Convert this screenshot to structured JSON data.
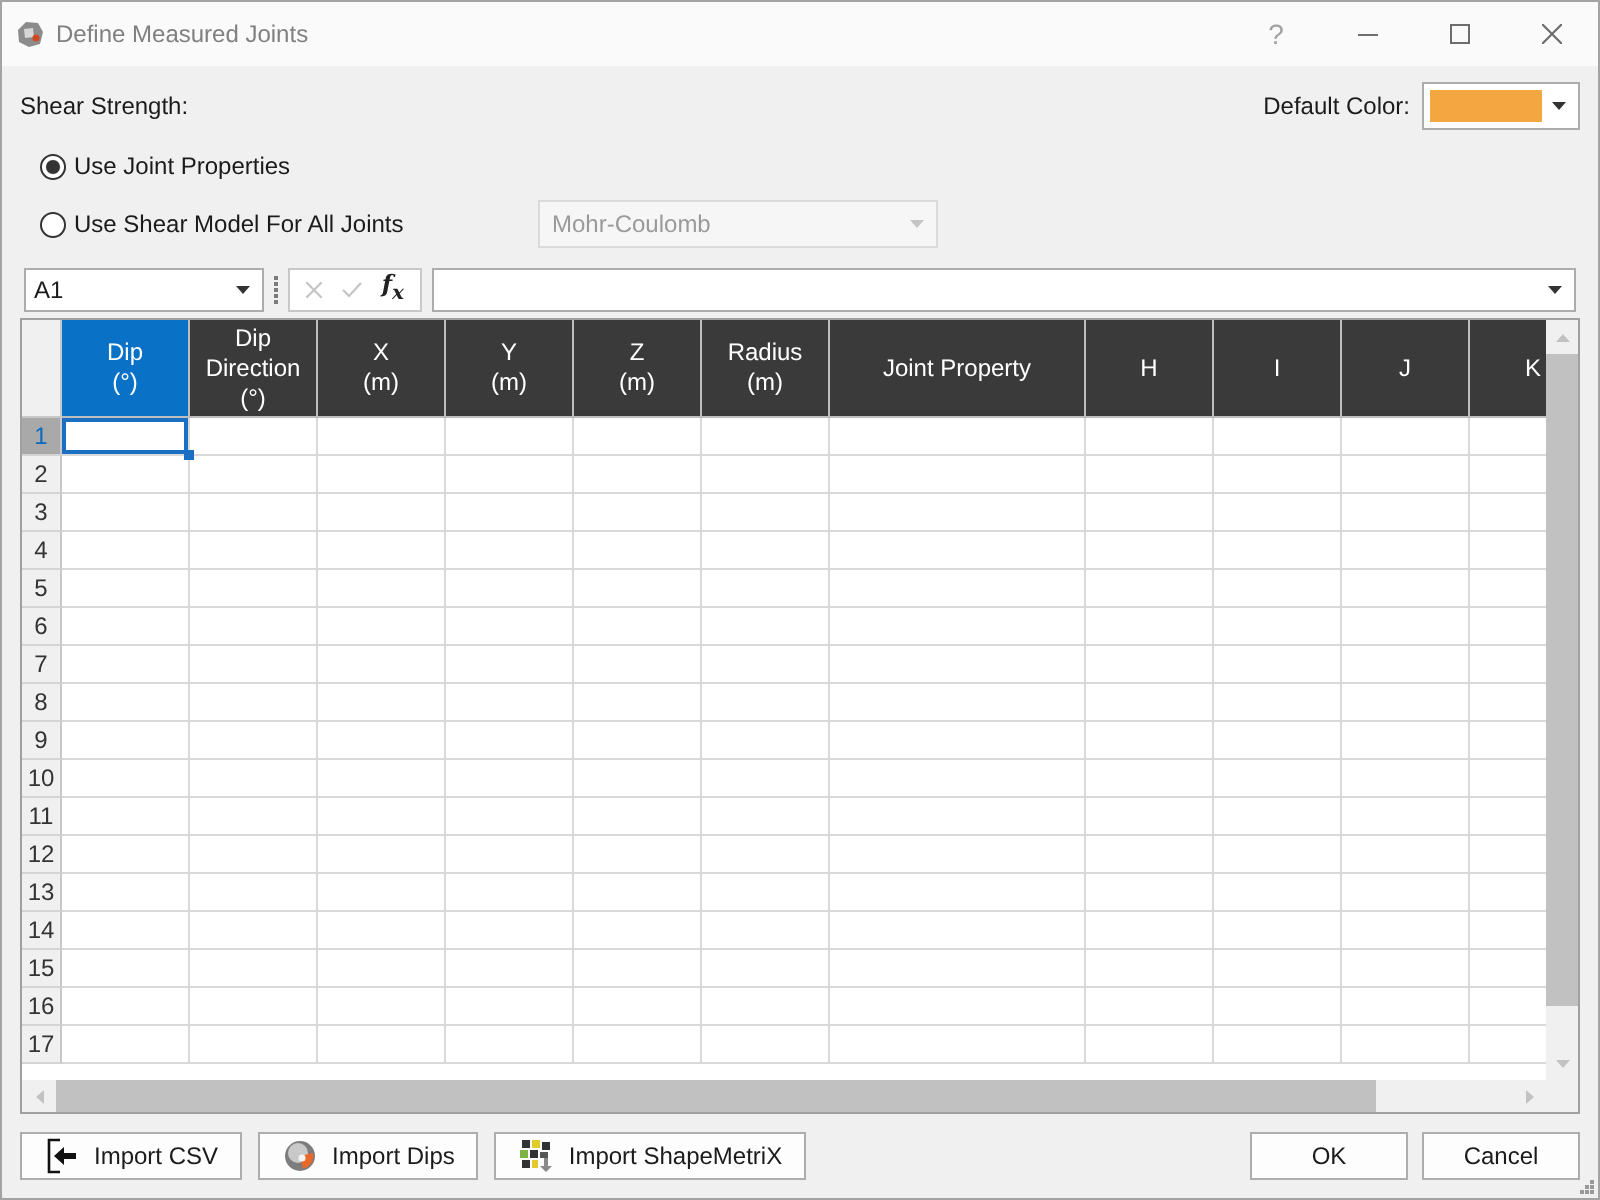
{
  "window": {
    "title": "Define Measured Joints",
    "help": "?"
  },
  "shear_strength": {
    "label": "Shear Strength:",
    "options": [
      {
        "label": "Use Joint Properties",
        "selected": true
      },
      {
        "label": "Use Shear Model For All Joints",
        "selected": false,
        "model": {
          "value": "Mohr-Coulomb",
          "disabled": true
        }
      }
    ]
  },
  "default_color": {
    "label": "Default Color:",
    "color": "#f4a641"
  },
  "formula_bar": {
    "cell_reference": "A1",
    "cancel": {
      "disabled": true
    },
    "accept": {
      "disabled": true
    },
    "function_button": "f$_{x}$"
  },
  "grid": {
    "columns": [
      {
        "lines": [
          "Dip",
          "(°)"
        ],
        "kind": "value",
        "selected": true
      },
      {
        "lines": [
          "Dip",
          "Direction",
          "(°)"
        ],
        "kind": "value",
        "selected": false
      },
      {
        "lines": [
          "X",
          "(m)"
        ],
        "kind": "value",
        "selected": false
      },
      {
        "lines": [
          "Y",
          "(m)"
        ],
        "kind": "value",
        "selected": false
      },
      {
        "lines": [
          "Z",
          "(m)"
        ],
        "kind": "value",
        "selected": false
      },
      {
        "lines": [
          "Radius",
          "(m)"
        ],
        "kind": "value",
        "selected": false
      },
      {
        "lines": [
          "Joint Property"
        ],
        "kind": "property",
        "selected": false
      },
      {
        "lines": [
          "H"
        ],
        "kind": "value",
        "selected": false
      },
      {
        "lines": [
          "I"
        ],
        "kind": "value",
        "selected": false
      },
      {
        "lines": [
          "J"
        ],
        "kind": "value",
        "selected": false
      },
      {
        "lines": [
          "K"
        ],
        "kind": "value",
        "selected": false
      }
    ],
    "rows": [
      {
        "label": "1",
        "selected": true
      },
      {
        "label": "2",
        "selected": false
      },
      {
        "label": "3",
        "selected": false
      },
      {
        "label": "4",
        "selected": false
      },
      {
        "label": "5",
        "selected": false
      },
      {
        "label": "6",
        "selected": false
      },
      {
        "label": "7",
        "selected": false
      },
      {
        "label": "8",
        "selected": false
      },
      {
        "label": "9",
        "selected": false
      },
      {
        "label": "10",
        "selected": false
      },
      {
        "label": "11",
        "selected": false
      },
      {
        "label": "12",
        "selected": false
      },
      {
        "label": "13",
        "selected": false
      },
      {
        "label": "14",
        "selected": false
      },
      {
        "label": "15",
        "selected": false
      },
      {
        "label": "16",
        "selected": false
      },
      {
        "label": "17",
        "selected": false
      }
    ]
  },
  "import_buttons": [
    {
      "label": "Import CSV",
      "kind": "csv"
    },
    {
      "label": "Import Dips",
      "kind": "dips"
    },
    {
      "label": "Import ShapeMetriX",
      "kind": "shapemetrix"
    }
  ],
  "dialog_buttons": [
    "OK",
    "Cancel"
  ]
}
